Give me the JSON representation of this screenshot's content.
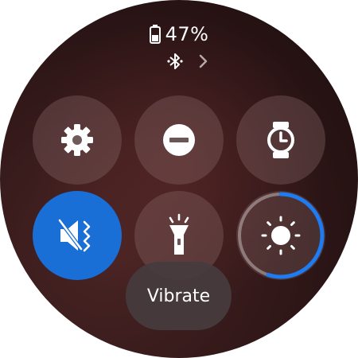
{
  "status": {
    "battery_percent_label": "47%",
    "battery_level": 0.47
  },
  "tiles": [
    {
      "name": "settings",
      "icon": "gear-icon"
    },
    {
      "name": "do-not-disturb",
      "icon": "minus-circle-icon"
    },
    {
      "name": "watch-always-on",
      "icon": "watch-icon"
    },
    {
      "name": "sound-mode-vibrate",
      "icon": "vibrate-mute-icon",
      "active": true
    },
    {
      "name": "flashlight",
      "icon": "flashlight-icon"
    },
    {
      "name": "brightness",
      "icon": "sun-icon",
      "level": 0.55
    }
  ],
  "toast": {
    "label": "Vibrate"
  },
  "colors": {
    "accent": "#1a6fd6",
    "ring": "#1e7cf0",
    "tile_bg": "rgba(140,110,110,0.35)"
  }
}
